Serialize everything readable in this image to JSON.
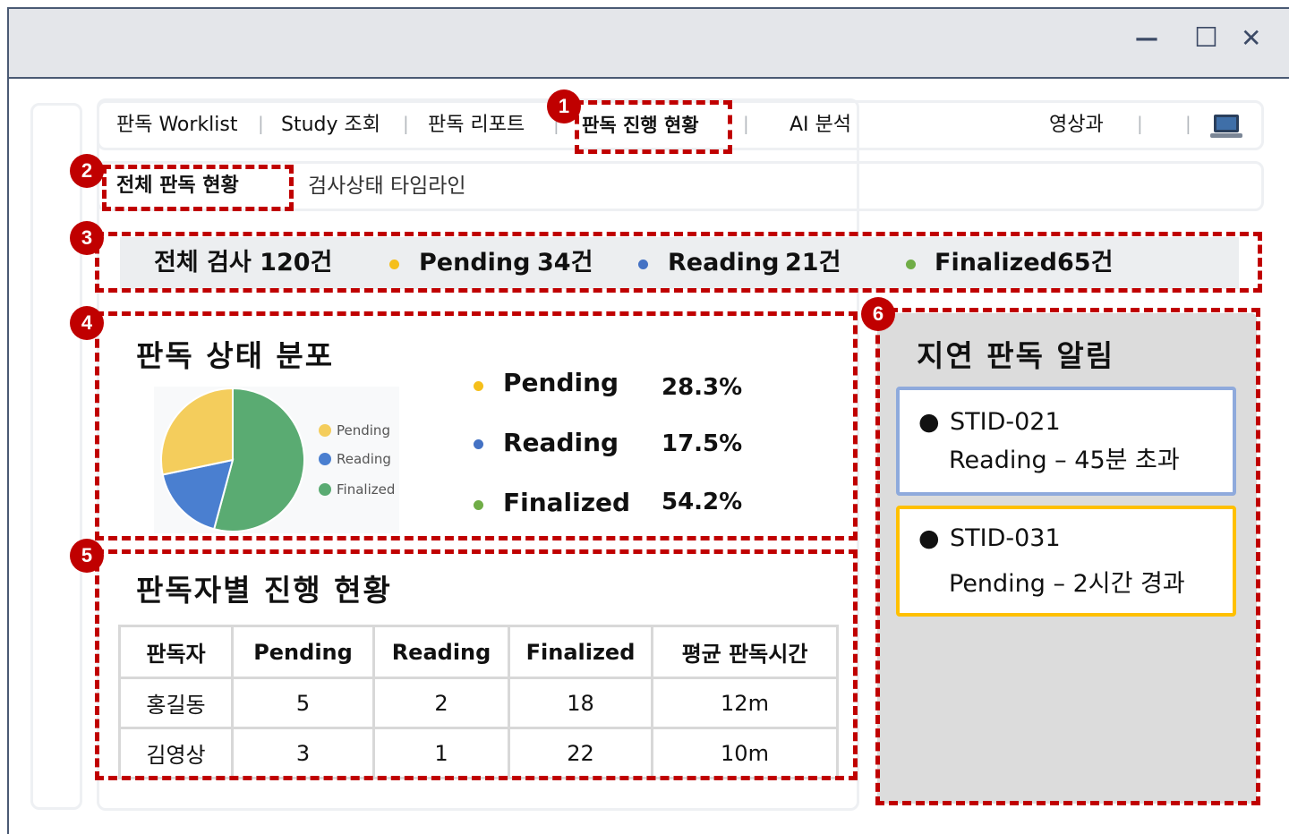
{
  "window": {
    "minimize_glyph": "—",
    "maximize_glyph": "☐",
    "close_glyph": "✕"
  },
  "nav": {
    "items": [
      "판독 Worklist",
      "Study 조회",
      "판독 리포트",
      "판독 진행 현황",
      "AI 분석"
    ],
    "active": "판독 진행 현황",
    "department": "영상과",
    "device_icon": "laptop-icon"
  },
  "subnav": {
    "items": [
      "전체 판독 현황",
      "검사상태 타임라인"
    ],
    "active": "전체 판독 현황"
  },
  "summary": {
    "total": "전체 검사 120건",
    "pending_label": "Pending",
    "pending_count": "34건",
    "reading_label": "Reading",
    "reading_count": "21건",
    "finalized_label": "Finalized",
    "finalized_count": "65건"
  },
  "colors": {
    "pending": "#f5bf1b",
    "reading": "#4472c4",
    "finalized": "#70ad47",
    "highlight": "#c00000",
    "alert_reading_border": "#8faadc",
    "alert_pending_border": "#ffc000"
  },
  "distribution": {
    "title": "판독 상태 분포",
    "rows": [
      {
        "label": "Pending",
        "pct": "28.3%"
      },
      {
        "label": "Reading",
        "pct": "17.5%"
      },
      {
        "label": "Finalized",
        "pct": "54.2%"
      }
    ]
  },
  "chart_data": {
    "type": "pie",
    "categories": [
      "Pending",
      "Reading",
      "Finalized"
    ],
    "values": [
      28.3,
      17.5,
      54.2
    ],
    "legend": [
      "Pending",
      "Reading",
      "Finalized"
    ],
    "colors": [
      "#f4cd5c",
      "#4a7fd0",
      "#5aab72"
    ],
    "legend_position": "right"
  },
  "readers": {
    "title": "판독자별 진행 현황",
    "headers": [
      "판독자",
      "Pending",
      "Reading",
      "Finalized",
      "평균 판독시간"
    ],
    "rows": [
      [
        "홍길동",
        "5",
        "2",
        "18",
        "12m"
      ],
      [
        "김영상",
        "3",
        "1",
        "22",
        "10m"
      ]
    ]
  },
  "alerts": {
    "title": "지연 판독 알림",
    "items": [
      {
        "id": "STID-021",
        "detail": "Reading – 45분 초과"
      },
      {
        "id": "STID-031",
        "detail": "Pending – 2시간 경과"
      }
    ]
  },
  "annotations": [
    "1",
    "2",
    "3",
    "4",
    "5",
    "6"
  ]
}
